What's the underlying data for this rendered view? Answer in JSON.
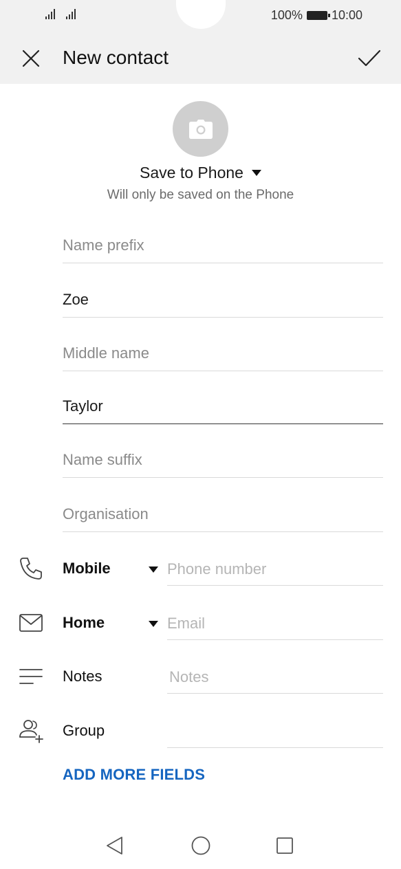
{
  "status_bar": {
    "battery_text": "100%",
    "time": "10:00"
  },
  "header": {
    "title": "New contact"
  },
  "save_location": {
    "label": "Save to Phone",
    "subtitle": "Will only be saved on the Phone"
  },
  "fields": {
    "name_prefix": "Name prefix",
    "first_name": "Zoe",
    "middle_name": "Middle name",
    "last_name": "Taylor",
    "name_suffix": "Name suffix",
    "organisation": "Organisation"
  },
  "phone": {
    "type_label": "Mobile",
    "placeholder": "Phone number"
  },
  "email": {
    "type_label": "Home",
    "placeholder": "Email"
  },
  "notes": {
    "label": "Notes",
    "placeholder": "Notes"
  },
  "group": {
    "label": "Group"
  },
  "add_more_label": "ADD MORE FIELDS",
  "colors": {
    "accent": "#1565c0",
    "header_bg": "#f1f1f1",
    "avatar_bg": "#cfcfcf"
  }
}
